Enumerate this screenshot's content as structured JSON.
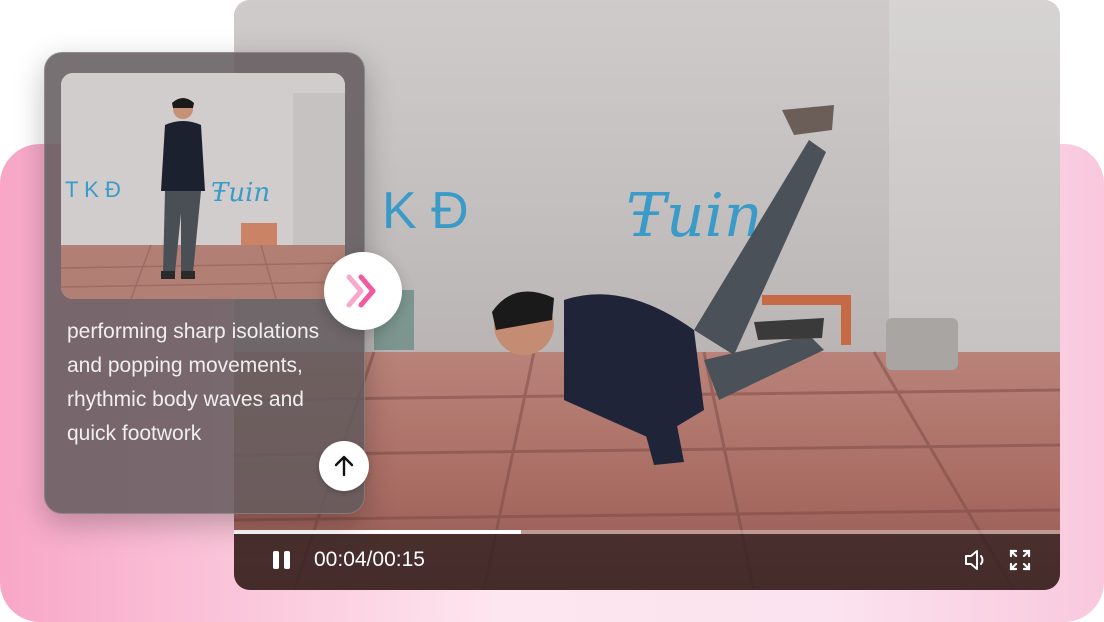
{
  "caption": {
    "text": "performing sharp isolations and popping movements, rhythmic body waves and quick footwork"
  },
  "player": {
    "time_display": "00:04/00:15",
    "progress_fraction": 0.3478
  },
  "graffiti": {
    "main_letters": "K Đ",
    "main_script": "Ŧuin",
    "thumb_letters": "T K Đ",
    "thumb_script": "Ŧuin"
  },
  "icons": {
    "forward": "double-chevron-right-icon",
    "upload": "arrow-up-icon",
    "pause": "pause-icon",
    "volume": "speaker-icon",
    "fullscreen": "fullscreen-icon"
  },
  "colors": {
    "accent_pink": "#f25aa0",
    "accent_pink_light": "#f7a8cc",
    "graffiti_blue": "#3a9bc9",
    "backdrop_pink": "#f8a7c6"
  }
}
